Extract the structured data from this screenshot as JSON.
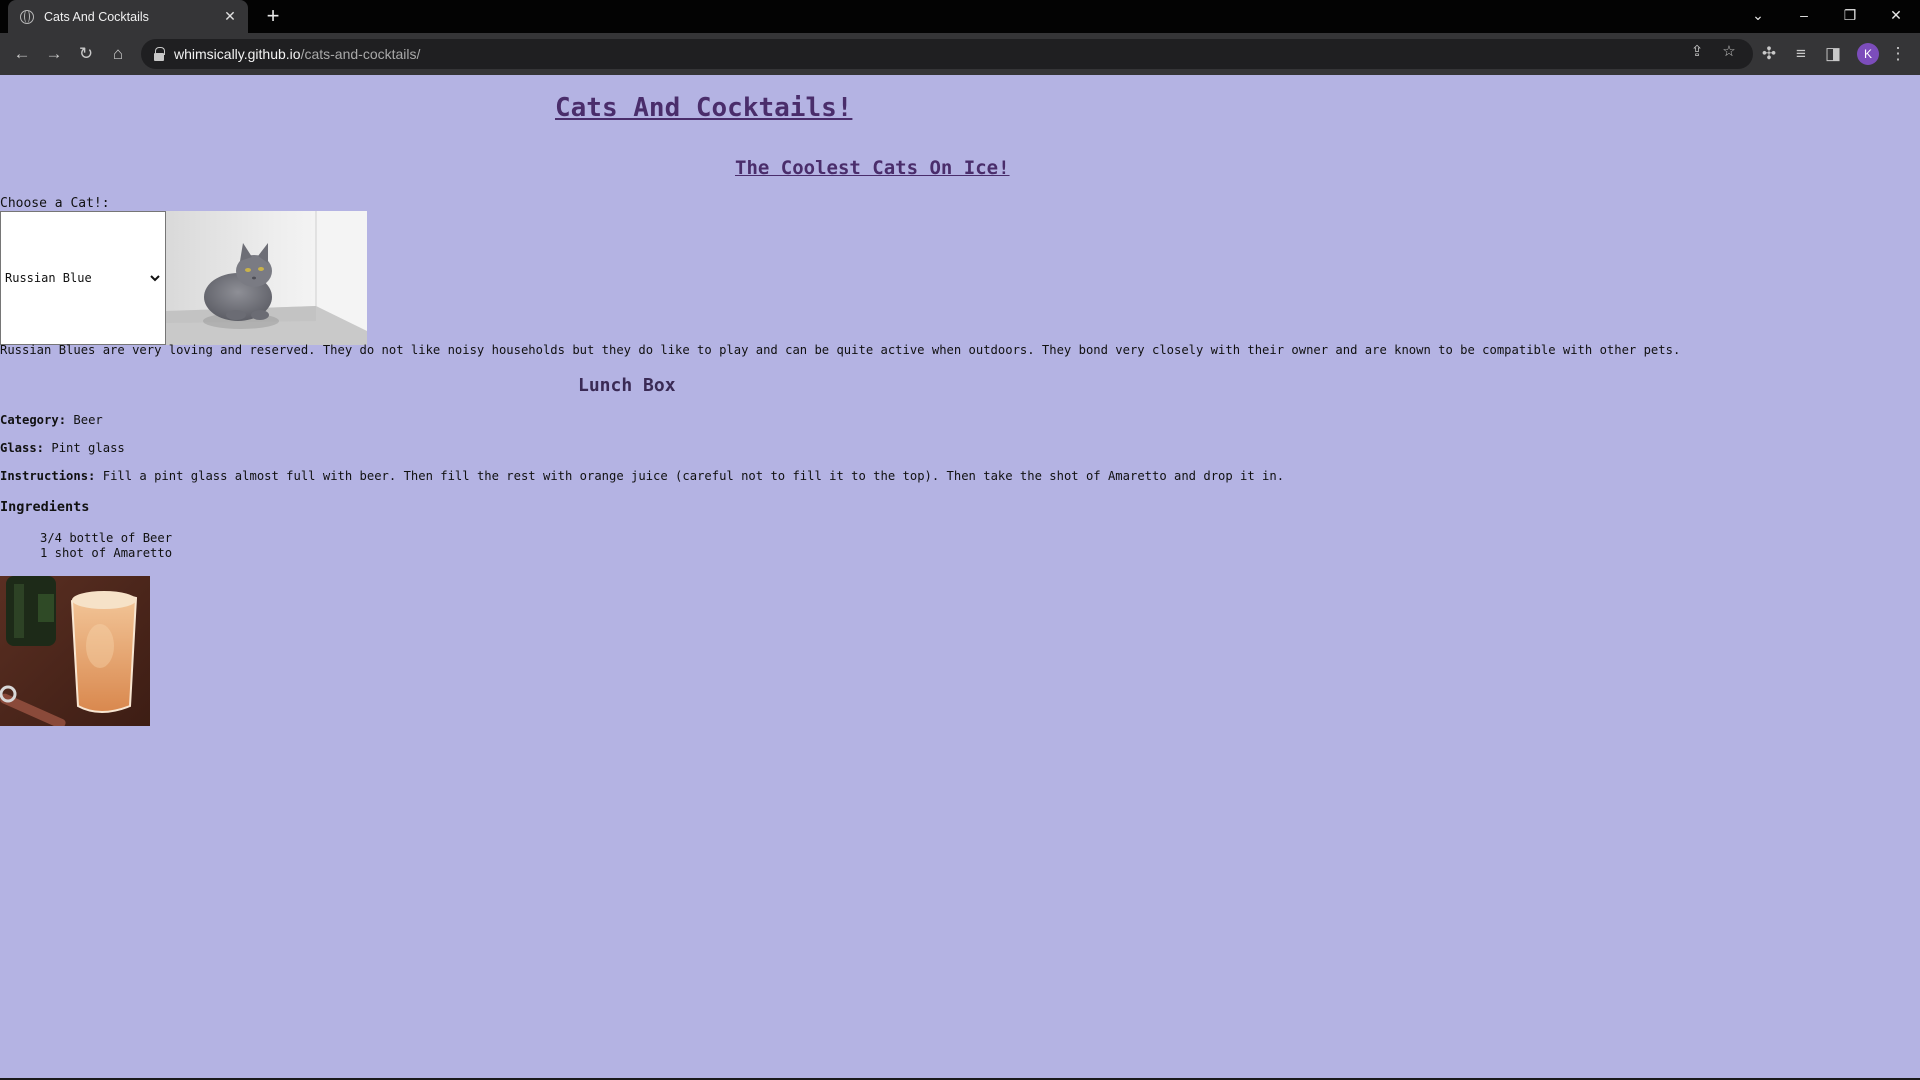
{
  "browser": {
    "tab_title": "Cats And Cocktails",
    "url_host": "whimsically.github.io",
    "url_path": "/cats-and-cocktails/",
    "profile_initial": "K"
  },
  "page": {
    "title": "Cats And Cocktails!",
    "subtitle": "The Coolest Cats On Ice!",
    "background_color": "#b4b3e3",
    "title_color": "#4a2d6b"
  },
  "cat": {
    "choose_label": "Choose a Cat!:",
    "selected": "Russian Blue",
    "description": "Russian Blues are very loving and reserved. They do not like noisy households but they do like to play and can be quite active when outdoors. They bond very closely with their owner and are known to be compatible with other pets."
  },
  "drink": {
    "name": "Lunch Box",
    "category_label": "Category:",
    "category": "Beer",
    "glass_label": "Glass:",
    "glass": "Pint glass",
    "instructions_label": "Instructions:",
    "instructions": "Fill a pint glass almost full with beer. Then fill the rest with orange juice (careful not to fill it to the top). Then take the shot of Amaretto and drop it in.",
    "ingredients_heading": "Ingredients",
    "ingredients": [
      "3/4 bottle of Beer",
      "1 shot of Amaretto"
    ]
  }
}
